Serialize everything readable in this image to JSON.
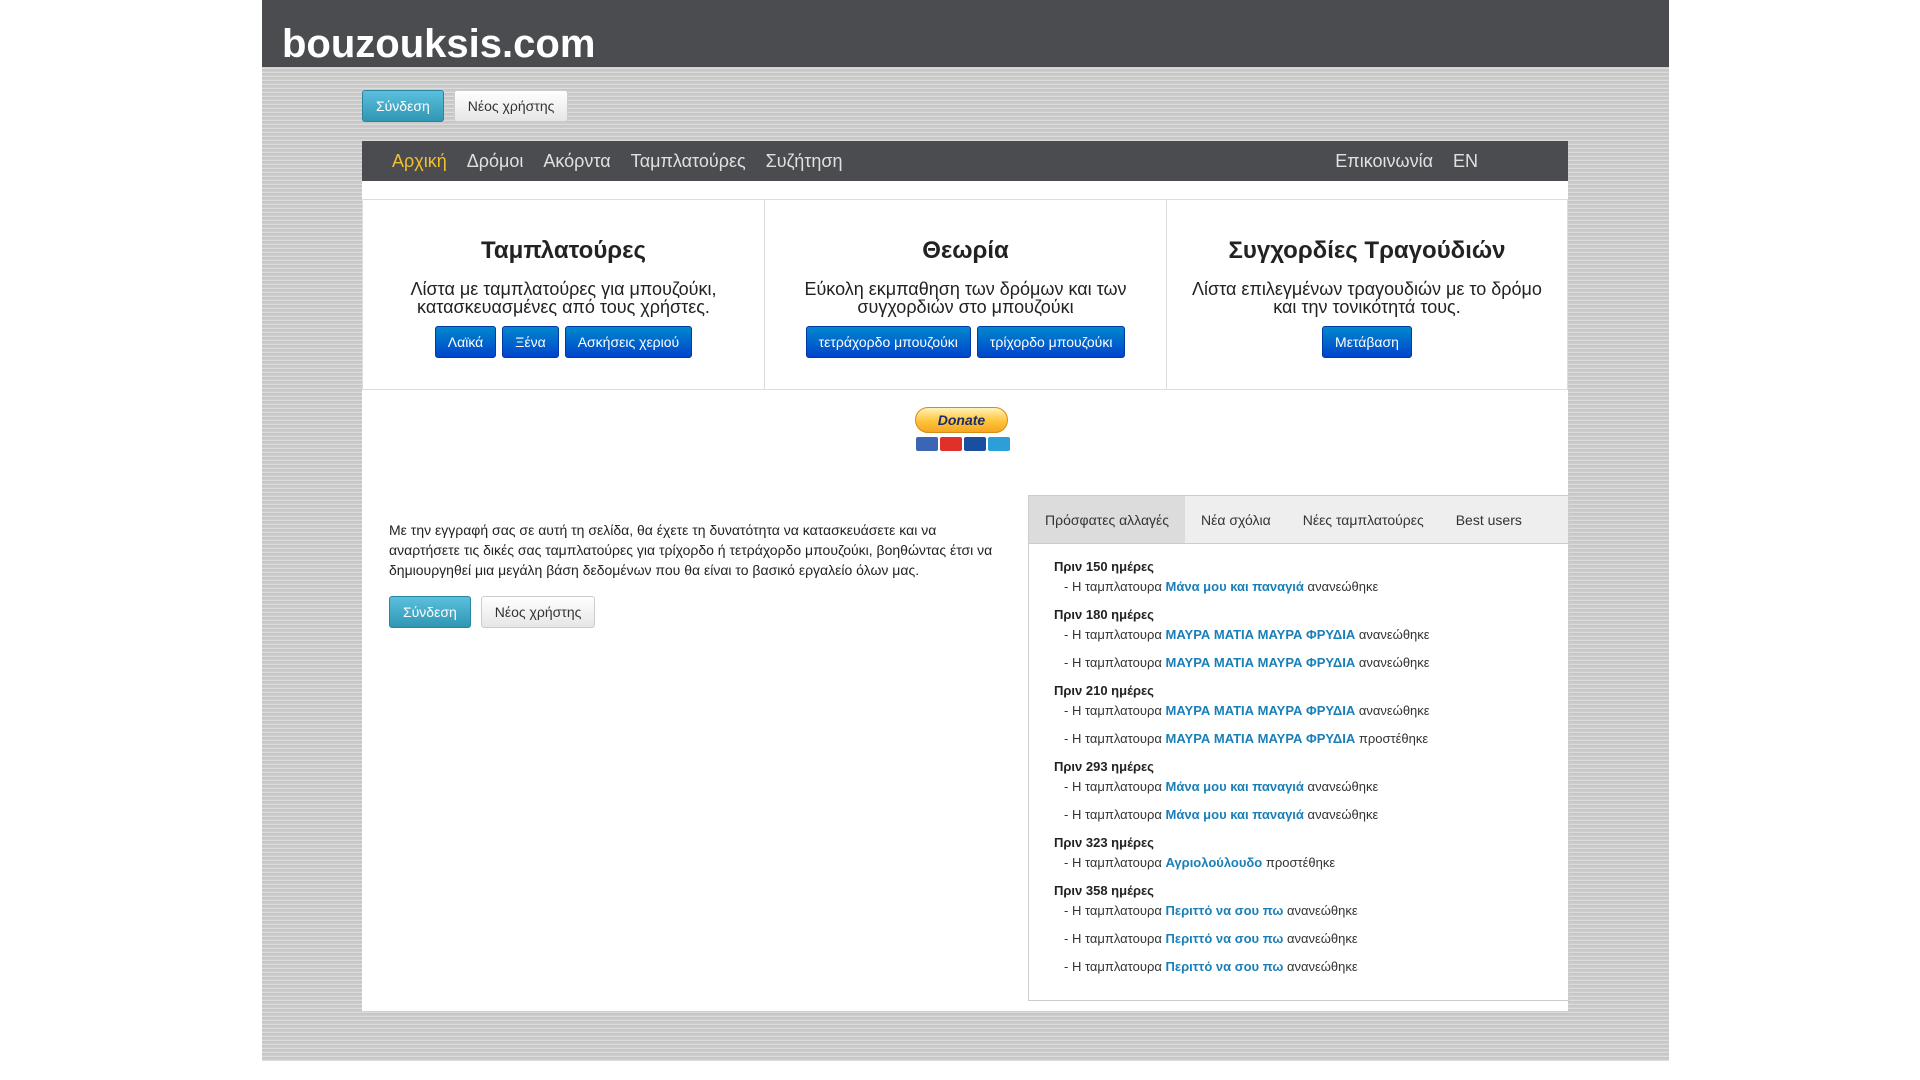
{
  "site_title": "bouzouksis.com",
  "auth": {
    "login": "Σύνδεση",
    "register": "Νέος χρήστης"
  },
  "nav": {
    "left": [
      "Αρχική",
      "Δρόμοι",
      "Ακόρντα",
      "Ταμπλατούρες",
      "Συζήτηση"
    ],
    "right": [
      "Επικοινωνία",
      "EN"
    ]
  },
  "features": [
    {
      "title": "Ταμπλατούρες",
      "text": "Λίστα με ταμπλατούρες για μπουζούκι, κατασκευασμένες από τους χρήστες.",
      "buttons": [
        "Λαϊκά",
        "Ξένα",
        "Ασκήσεις χεριού"
      ]
    },
    {
      "title": "Θεωρία",
      "text": "Εύκολη εκμπαθηση των δρόμων και των συγχορδιών στο μπουζούκι",
      "buttons": [
        "τετράχορδο μπουζούκι",
        "τρίχορδο μπουζούκι"
      ]
    },
    {
      "title": "Συγχορδίες Τραγούδιών",
      "text": "Λίστα επιλεγμένων τραγουδιών με το δρόμο και την τονικότητά τους.",
      "buttons": [
        "Μετάβαση"
      ]
    }
  ],
  "donate": {
    "label": "Donate",
    "cards": [
      "#3a66b5",
      "#e0302a",
      "#1a4fa0",
      "#2d9fd8"
    ]
  },
  "intro": "Με την εγγραφή σας σε αυτή τη σελίδα, θα έχετε τη δυνατότητα να κατασκευάσετε και να αναρτήσετε τις δικές σας ταμπλατούρες για τρίχορδο ή τετράχορδο μπουζούκι, βοηθώντας έτσι να δημιουργηθεί μια μεγάλη βάση δεδομένων που θα είναι το βασικό εργαλείο όλων μας.",
  "tabs": [
    "Πρόσφατες αλλαγές",
    "Νέα σχόλια",
    "Νέες ταμπλατούρες",
    "Best users"
  ],
  "feed": [
    {
      "period": "Πριν 150 ημέρες",
      "entries": [
        {
          "prefix": "- Η ταμπλατουρα",
          "title": "Μάνα μου και παναγιά",
          "action": "ανανεώθηκε"
        }
      ]
    },
    {
      "period": "Πριν 180 ημέρες",
      "entries": [
        {
          "prefix": "- Η ταμπλατουρα",
          "title": "ΜΑΥΡΑ ΜΑΤΙΑ ΜΑΥΡΑ ΦΡΥΔΙΑ",
          "action": "ανανεώθηκε"
        },
        {
          "prefix": "- Η ταμπλατουρα",
          "title": "ΜΑΥΡΑ ΜΑΤΙΑ ΜΑΥΡΑ ΦΡΥΔΙΑ",
          "action": "ανανεώθηκε"
        }
      ]
    },
    {
      "period": "Πριν 210 ημέρες",
      "entries": [
        {
          "prefix": "- Η ταμπλατουρα",
          "title": "ΜΑΥΡΑ ΜΑΤΙΑ ΜΑΥΡΑ ΦΡΥΔΙΑ",
          "action": "ανανεώθηκε"
        },
        {
          "prefix": "- Η ταμπλατουρα",
          "title": "ΜΑΥΡΑ ΜΑΤΙΑ ΜΑΥΡΑ ΦΡΥΔΙΑ",
          "action": "προστέθηκε"
        }
      ]
    },
    {
      "period": "Πριν 293 ημέρες",
      "entries": [
        {
          "prefix": "- Η ταμπλατουρα",
          "title": "Μάνα μου και παναγιά",
          "action": "ανανεώθηκε"
        },
        {
          "prefix": "- Η ταμπλατουρα",
          "title": "Μάνα μου και παναγιά",
          "action": "ανανεώθηκε"
        }
      ]
    },
    {
      "period": "Πριν 323 ημέρες",
      "entries": [
        {
          "prefix": "- Η ταμπλατουρα",
          "title": "Αγριολούλουδο",
          "action": "προστέθηκε"
        }
      ]
    },
    {
      "period": "Πριν 358 ημέρες",
      "entries": [
        {
          "prefix": "- Η ταμπλατουρα",
          "title": "Περιττό να σου πω",
          "action": "ανανεώθηκε"
        },
        {
          "prefix": "- Η ταμπλατουρα",
          "title": "Περιττό να σου πω",
          "action": "ανανεώθηκε"
        },
        {
          "prefix": "- Η ταμπλατουρα",
          "title": "Περιττό να σου πω",
          "action": "ανανεώθηκε"
        }
      ]
    }
  ]
}
